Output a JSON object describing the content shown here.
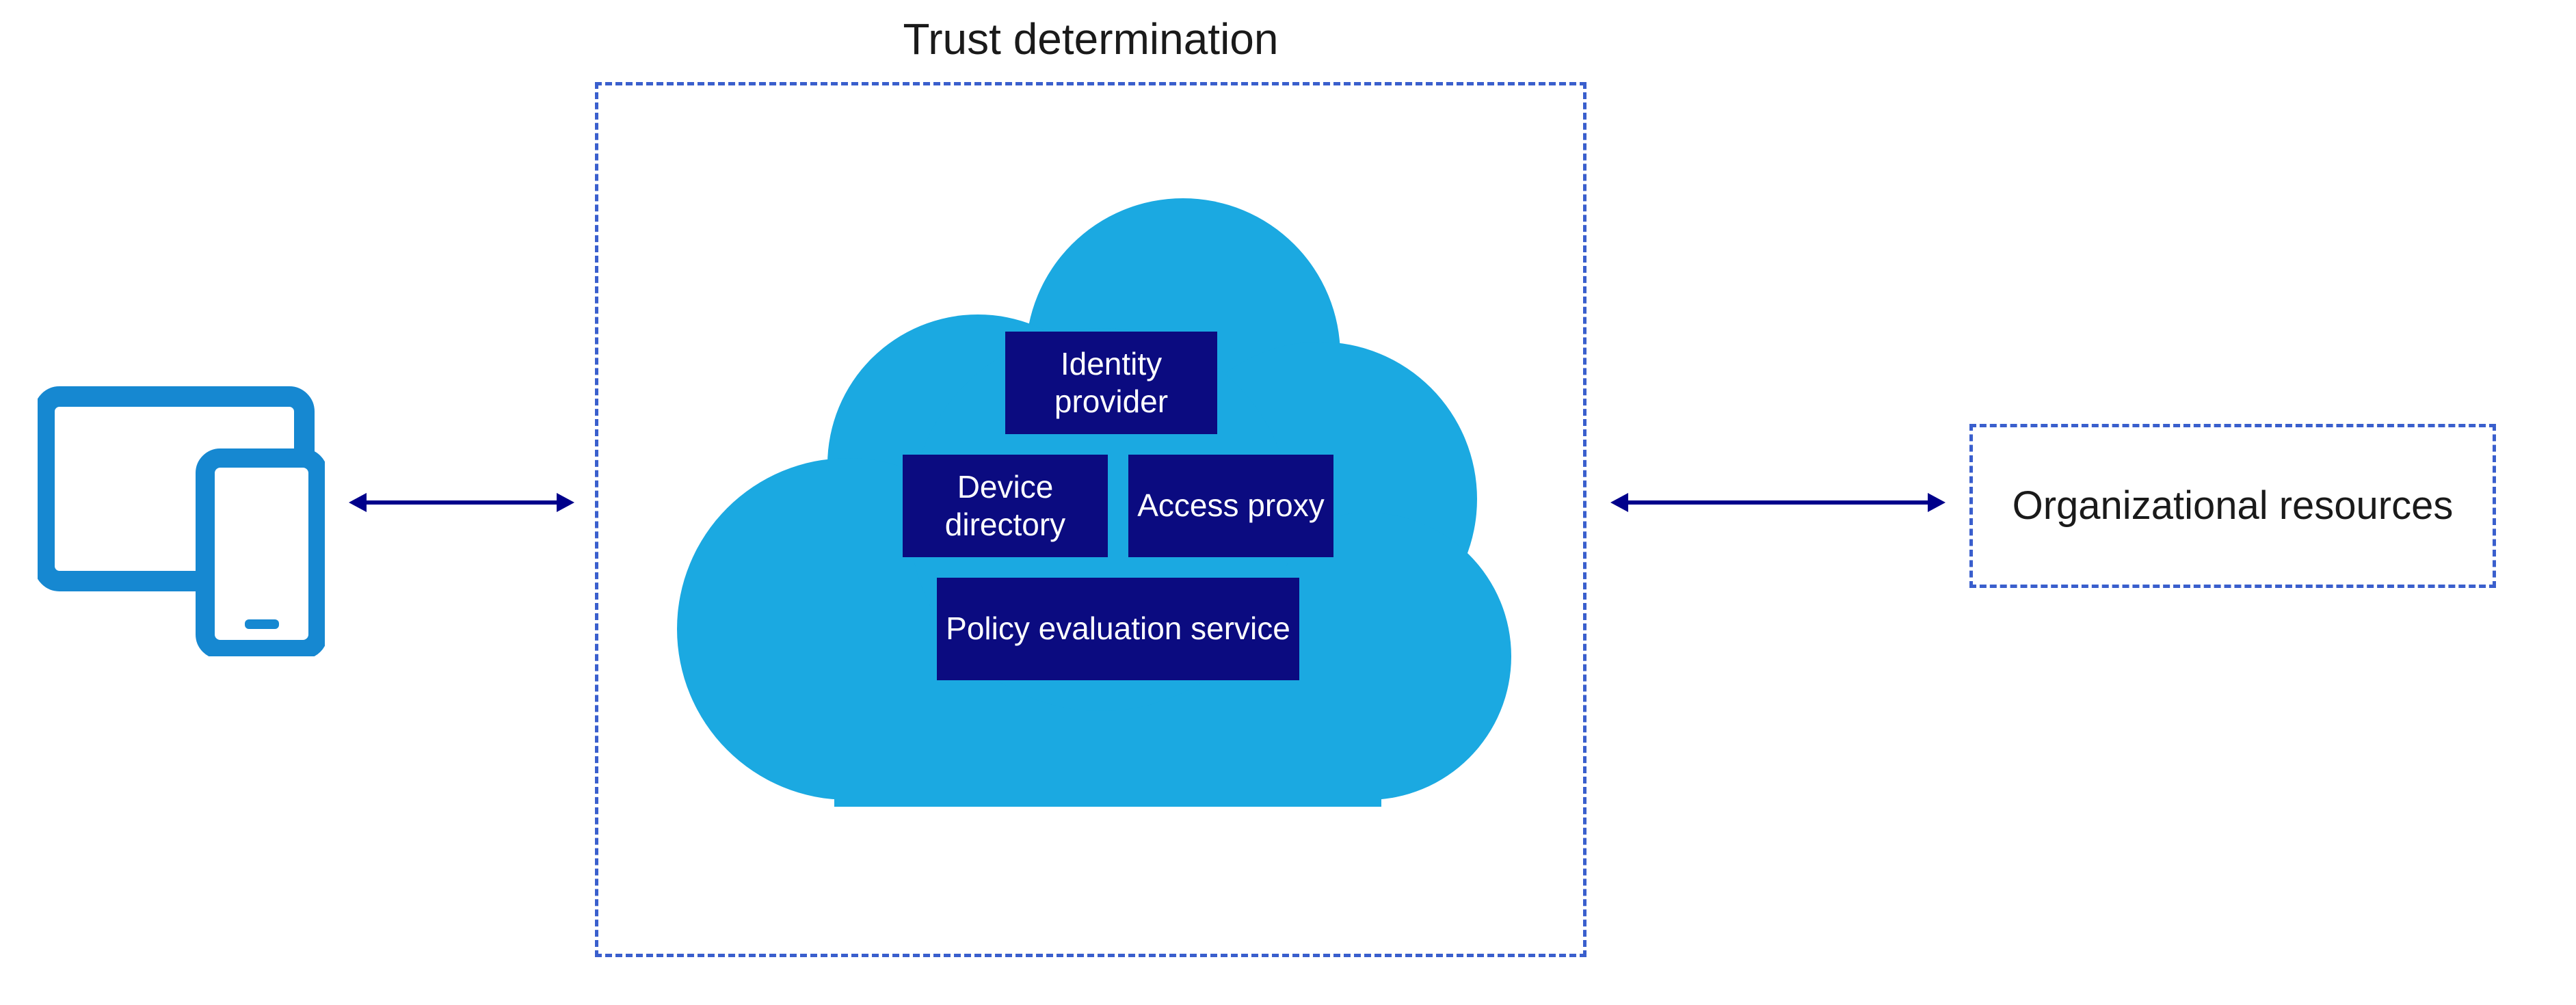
{
  "title": "Trust determination",
  "components": {
    "identity": "Identity provider",
    "device": "Device directory",
    "access": "Access proxy",
    "policy": "Policy evaluation service"
  },
  "org_resources": "Organizational resources",
  "colors": {
    "cloud": "#1BA9E1",
    "component_bg": "#0b0b80",
    "dashed_border": "#3a5fcd",
    "device_icon": "#1688d1",
    "arrow": "#00008b"
  }
}
